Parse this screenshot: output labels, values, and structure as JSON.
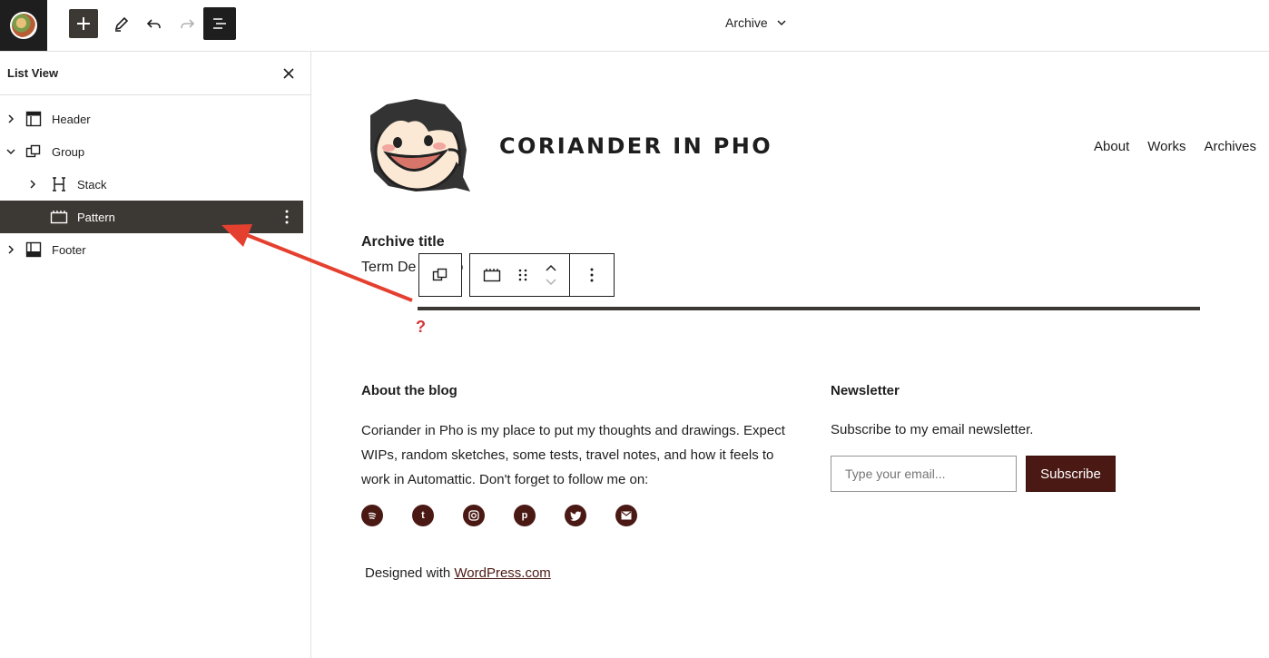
{
  "topbar": {
    "document_title": "Archive",
    "icons": {
      "add": "plus-icon",
      "edit": "pencil-icon",
      "undo": "undo-icon",
      "redo": "redo-icon",
      "list_view": "list-view-icon"
    }
  },
  "sidebar": {
    "title": "List View",
    "items": [
      {
        "label": "Header",
        "icon": "template-part-header-icon",
        "expanded": false,
        "depth": 0
      },
      {
        "label": "Group",
        "icon": "group-icon",
        "expanded": true,
        "depth": 0
      },
      {
        "label": "Stack",
        "icon": "stack-icon",
        "expanded": false,
        "depth": 1
      },
      {
        "label": "Pattern",
        "icon": "pattern-icon",
        "selected": true,
        "depth": 1
      },
      {
        "label": "Footer",
        "icon": "template-part-footer-icon",
        "expanded": false,
        "depth": 0
      }
    ]
  },
  "canvas": {
    "site_title": "CORIANDER IN PHO",
    "nav": [
      "About",
      "Works",
      "Archives"
    ],
    "archive_title": "Archive title",
    "term_description": "Term De",
    "term_description_tail": "o",
    "question_mark": "?",
    "footer": {
      "about_heading": "About the blog",
      "about_text": "Coriander in Pho is my place to put my thoughts and drawings. Expect WIPs, random sketches, some tests, travel notes, and how it feels to work in Automattic. Don't forget to follow me on:",
      "socials": [
        "spotify-icon",
        "tumblr-icon",
        "instagram-icon",
        "pinterest-icon",
        "twitter-icon",
        "mail-icon"
      ],
      "newsletter_heading": "Newsletter",
      "newsletter_text": "Subscribe to my email newsletter.",
      "email_placeholder": "Type your email...",
      "subscribe_label": "Subscribe",
      "credit_prefix": "Designed with ",
      "credit_link": "WordPress.com"
    }
  },
  "colors": {
    "accent_dark": "#3c3834",
    "brand_maroon": "#4a1914",
    "annotation_red": "#e5402f"
  }
}
